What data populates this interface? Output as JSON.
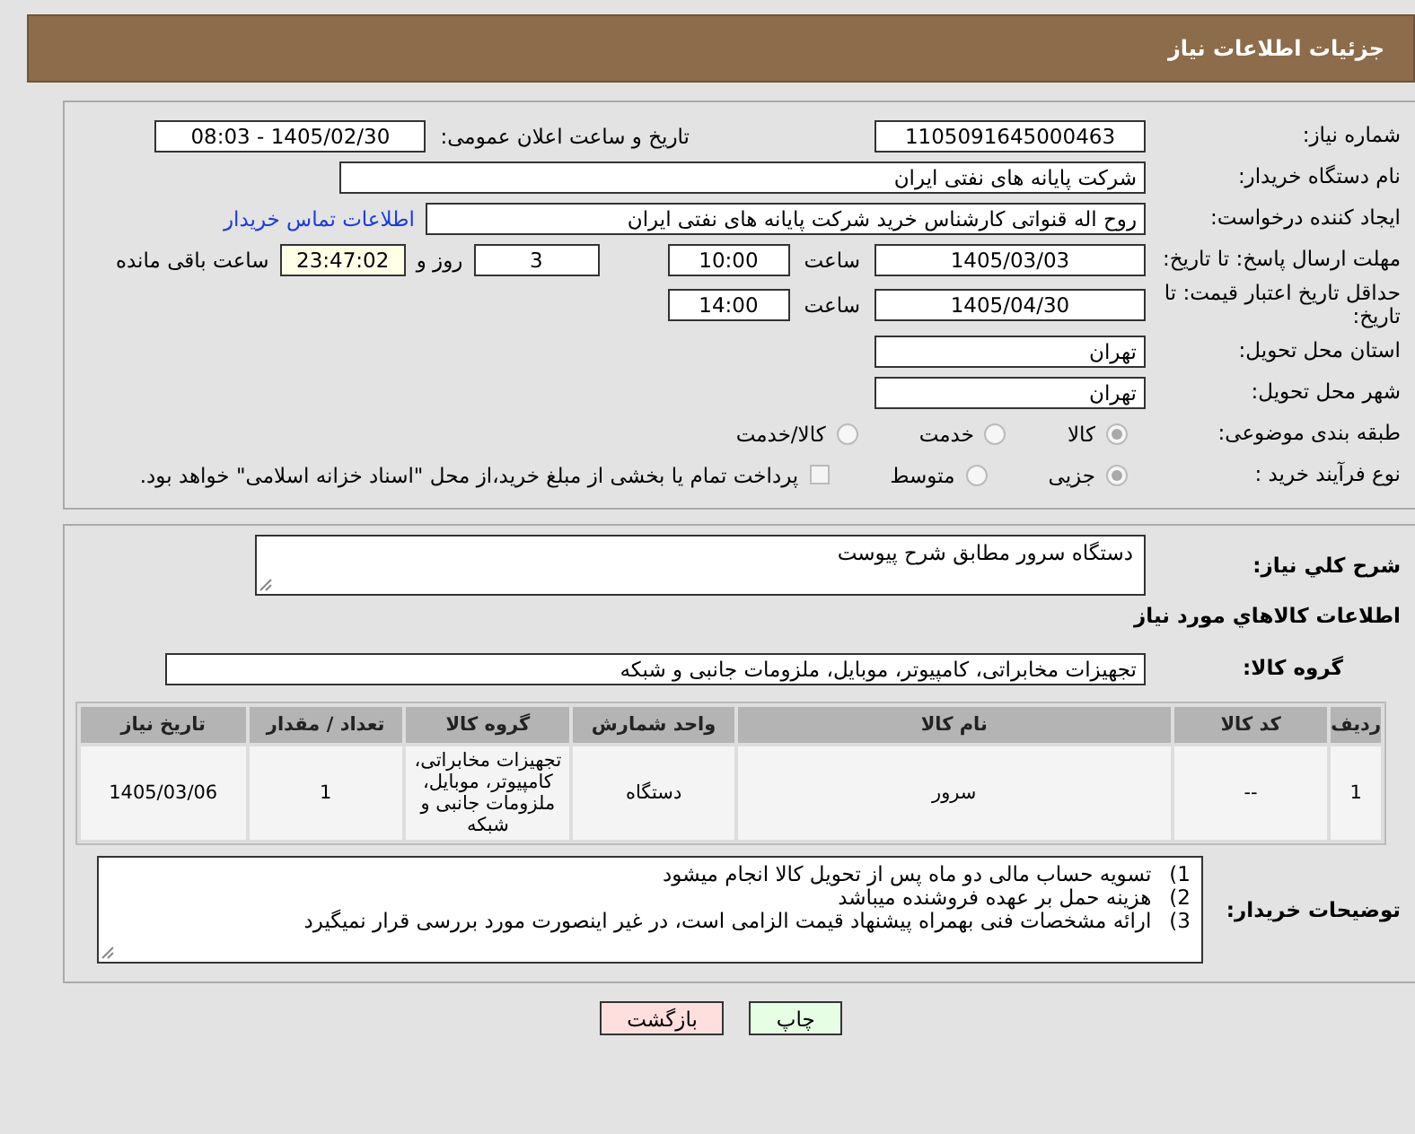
{
  "header": {
    "title": "جزئیات اطلاعات نیاز"
  },
  "need_number": {
    "label": "شماره نیاز:",
    "value": "1105091645000463"
  },
  "announce": {
    "label": "تاریخ و ساعت اعلان عمومی:",
    "value": "1405/02/30 - 08:03"
  },
  "buyer": {
    "label": "نام دستگاه خریدار:",
    "value": "شرکت پایانه های نفتی ایران"
  },
  "creator": {
    "label": "ایجاد کننده درخواست:",
    "value": "روح اله قنواتی کارشناس خرید شرکت پایانه های نفتی ایران",
    "link": "اطلاعات تماس خریدار"
  },
  "reply_deadline": {
    "label": "مهلت ارسال پاسخ: تا تاریخ:",
    "date": "1405/03/03",
    "time_label": "ساعت",
    "time": "10:00",
    "days": "3",
    "days_label": "روز و",
    "remaining": "23:47:02",
    "remaining_label": "ساعت باقی مانده"
  },
  "price_validity": {
    "label": "حداقل تاریخ اعتبار قیمت: تا تاریخ:",
    "date": "1405/04/30",
    "time_label": "ساعت",
    "time": "14:00"
  },
  "province": {
    "label": "استان محل تحویل:",
    "value": "تهران"
  },
  "city": {
    "label": "شهر محل تحویل:",
    "value": "تهران"
  },
  "category": {
    "label": "طبقه بندی موضوعی:",
    "options": [
      {
        "label": "کالا",
        "selected": true
      },
      {
        "label": "خدمت",
        "selected": false
      },
      {
        "label": "کالا/خدمت",
        "selected": false
      }
    ]
  },
  "process": {
    "label": "نوع فرآیند خرید :",
    "options": [
      {
        "label": "جزیی",
        "selected": true
      },
      {
        "label": "متوسط",
        "selected": false
      }
    ],
    "payment_note": {
      "checked": false,
      "text": "پرداخت تمام یا بخشی از مبلغ خرید،از محل \"اسناد خزانه اسلامی\" خواهد بود."
    }
  },
  "description": {
    "label": "شرح کلي نياز:",
    "value": "دستگاه سرور مطابق شرح پیوست"
  },
  "goods_heading": "اطلاعات کالاهاي مورد نياز",
  "goods_group": {
    "label": "گروه کالا:",
    "value": "تجهیزات مخابراتی، کامپیوتر، موبایل، ملزومات جانبی و شبکه"
  },
  "table": {
    "columns": [
      "ردیف",
      "کد کالا",
      "نام کالا",
      "واحد شمارش",
      "گروه کالا",
      "تعداد / مقدار",
      "تاریخ نیاز"
    ],
    "rows": [
      [
        "1",
        "--",
        "سرور",
        "دستگاه",
        "تجهیزات مخابراتی، کامپیوتر، موبایل، ملزومات جانبی و شبکه",
        "1",
        "1405/03/06"
      ]
    ]
  },
  "buyer_notes": {
    "label": "توضیحات خریدار:",
    "lines": [
      {
        "number": "1)",
        "text": "تسویه حساب مالی دو ماه پس از تحویل کالا انجام میشود"
      },
      {
        "number": "2)",
        "text": "هزینه حمل بر عهده فروشنده میباشد"
      },
      {
        "number": "3)",
        "text": "ارائه مشخصات فنی بهمراه پیشنهاد قیمت الزامی است، در غیر اینصورت مورد بررسی قرار نمیگیرد"
      }
    ]
  },
  "buttons": [
    {
      "label": "چاپ",
      "kind": "print"
    },
    {
      "label": "بازگشت",
      "kind": "back"
    }
  ]
}
